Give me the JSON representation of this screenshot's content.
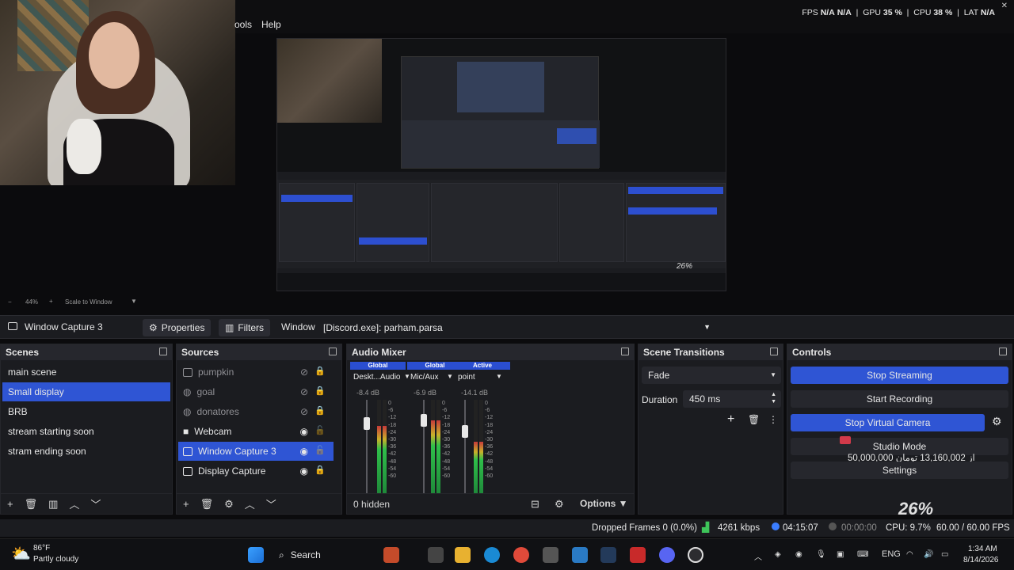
{
  "menu": {
    "tools": "ools",
    "help": "Help"
  },
  "stats": {
    "fps_label": "FPS",
    "fps": "N/A",
    "fps2": "N/A",
    "gpu_label": "GPU",
    "gpu": "35 %",
    "cpu_label": "CPU",
    "cpu": "38 %",
    "lat_label": "LAT",
    "lat": "N/A"
  },
  "preview": {
    "zoom": "44%",
    "scale_label": "Scale to Window",
    "overlay_pct": "26%"
  },
  "source_toolbar": {
    "source_name": "Window Capture 3",
    "properties": "Properties",
    "filters": "Filters",
    "window_label": "Window",
    "window_value": "[Discord.exe]: parham.parsa"
  },
  "scenes": {
    "title": "Scenes",
    "items": [
      "main scene",
      "Small display",
      "BRB",
      "stream starting soon",
      "stram ending soon"
    ],
    "selected_index": 1
  },
  "sources": {
    "title": "Sources",
    "items": [
      {
        "label": "pumpkin",
        "icon": "image-icon",
        "visible": false,
        "locked": true
      },
      {
        "label": "goal",
        "icon": "browser-icon",
        "visible": false,
        "locked": true
      },
      {
        "label": "donatores",
        "icon": "browser-icon",
        "visible": false,
        "locked": true
      },
      {
        "label": "Webcam",
        "icon": "camera-icon",
        "visible": true,
        "locked": false
      },
      {
        "label": "Window Capture 3",
        "icon": "window-icon",
        "visible": true,
        "locked": false
      },
      {
        "label": "Display Capture",
        "icon": "display-icon",
        "visible": true,
        "locked": true
      }
    ]
  },
  "mixer": {
    "title": "Audio Mixer",
    "channels": [
      {
        "tag": "Global",
        "name": "Deskt...Audio",
        "db": "-8.4 dB",
        "level": 0.72
      },
      {
        "tag": "Global",
        "name": "Mic/Aux",
        "db": "-6.9 dB",
        "level": 0.78
      },
      {
        "tag": "Active",
        "name": "point",
        "db": "-14.1 dB",
        "level": 0.55
      }
    ],
    "scale": [
      "0",
      "-6",
      "-12",
      "-18",
      "-24",
      "-30",
      "-36",
      "-42",
      "-48",
      "-54",
      "-60"
    ],
    "hidden_label": "0 hidden",
    "options_label": "Options"
  },
  "transitions": {
    "title": "Scene Transitions",
    "transition": "Fade",
    "duration_label": "Duration",
    "duration_value": "450 ms"
  },
  "controls": {
    "title": "Controls",
    "stop_streaming": "Stop Streaming",
    "start_recording": "Start Recording",
    "stop_virtual_camera": "Stop Virtual Camera",
    "studio_mode": "Studio Mode",
    "donation_text": "50,000,000 از 13,160,002 تومان",
    "settings": "Settings",
    "overlay_pct": "26%"
  },
  "status": {
    "dropped": "Dropped Frames 0 (0.0%)",
    "kbps": "4261 kbps",
    "stream_time": "04:15:07",
    "rec_time": "00:00:00",
    "cpu": "CPU: 9.7%",
    "fps": "60.00 / 60.00 FPS"
  },
  "taskbar": {
    "weather_temp": "86°F",
    "weather_desc": "Partly cloudy",
    "search": "Search",
    "lang": "ENG",
    "time": "1:34 AM",
    "date": "8/14/2026"
  },
  "colors": {
    "accent": "#2f55d4",
    "panel": "#1b1c20",
    "title": "#26272d"
  }
}
